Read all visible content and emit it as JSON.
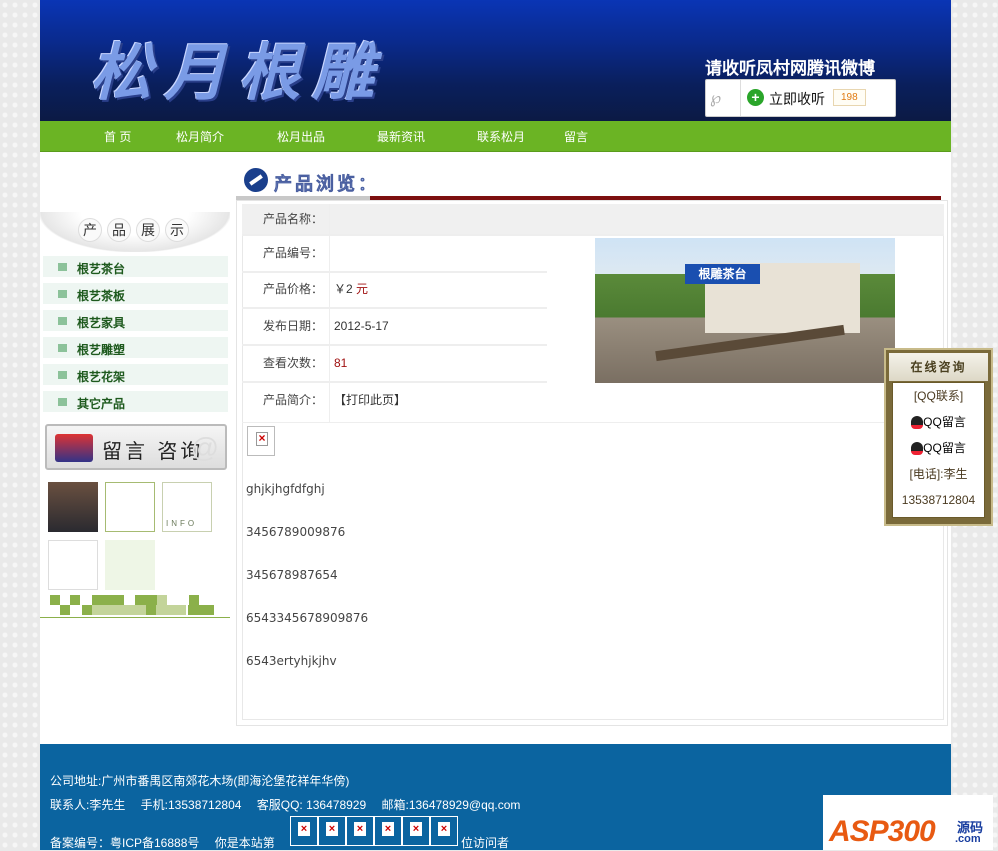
{
  "header": {
    "logo_text": "松月根雕",
    "weibo_title": "请收听凤村网腾讯微博",
    "follow_label": "立即收听",
    "follow_count": "198"
  },
  "nav": [
    "首 页",
    "松月简介",
    "松月出品",
    "最新资讯",
    "联系松月",
    "留言"
  ],
  "sidebar": {
    "title_chars": [
      "产",
      "品",
      "展",
      "示"
    ],
    "categories": [
      "根艺茶台",
      "根艺茶板",
      "根艺家具",
      "根艺雕塑",
      "根艺花架",
      "其它产品"
    ],
    "message_banner": "留言 咨询",
    "info_tile": "INFO"
  },
  "main": {
    "section_title": "产品浏览：",
    "fields": [
      {
        "label": "产品名称：",
        "value": ""
      },
      {
        "label": "产品编号：",
        "value": ""
      },
      {
        "label": "产品价格：",
        "value": "￥2",
        "unit": "元"
      },
      {
        "label": "发布日期：",
        "value": "2012-5-17"
      },
      {
        "label": "查看次数：",
        "value": "81"
      },
      {
        "label": "产品简介：",
        "value": "【打印此页】"
      }
    ],
    "image_sign": "根雕茶台",
    "description_lines": [
      "ghjkjhgfdfghj",
      "3456789009876",
      "345678987654",
      "6543345678909876",
      "6543ertyhjkjhv"
    ]
  },
  "qq_panel": {
    "title": "在线咨询",
    "qq_contact": "[QQ联系]",
    "qq_msg_1": "QQ留言",
    "qq_msg_2": "QQ留言",
    "phone_label": "[电话]:李生",
    "phone": "13538712804"
  },
  "footer": {
    "address": "公司地址:广州市番禺区南郊花木场(即海沦堡花祥年华傍)",
    "contact": "联系人:李先生　 手机:13538712804　 客服QQ: 136478929　 邮箱:136478929@qq.com",
    "icp": "备案编号：粤ICP备16888号　 你是本站第",
    "visitor_suffix": "位访问者"
  },
  "watermark": {
    "brand": "ASP300",
    "cn": "源码",
    "domain": ".com"
  },
  "colors": {
    "nav_green": "#6bb424",
    "footer_blue": "#0b64a0",
    "accent_red": "#7d1010"
  }
}
